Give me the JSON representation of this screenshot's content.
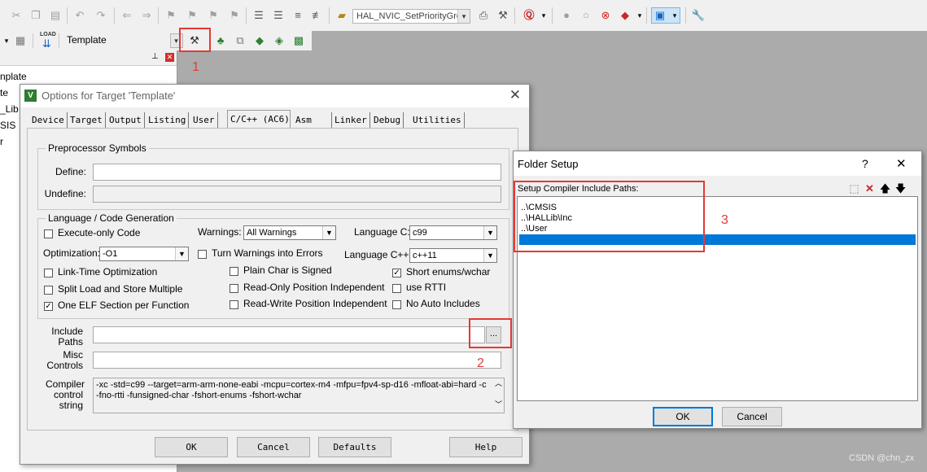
{
  "toolbar": {
    "function_combo": "HAL_NVIC_SetPriorityGro",
    "target_combo": "Template",
    "load_label": "LOAD"
  },
  "project_tree": [
    "nplate",
    "te",
    "_Lib",
    "SIS",
    "r"
  ],
  "annotations": {
    "n1": "1",
    "n2": "2",
    "n3": "3",
    "color": "#e53935"
  },
  "options_dialog": {
    "title": "Options for Target 'Template'",
    "tabs": [
      "Device",
      "Target",
      "Output",
      "Listing",
      "User",
      "C/C++ (AC6)",
      "Asm",
      "Linker",
      "Debug",
      "Utilities"
    ],
    "active_tab": "C/C++ (AC6)",
    "preprocessor": {
      "group_label": "Preprocessor Symbols",
      "define_label": "Define:",
      "define_value": "",
      "undefine_label": "Undefine:",
      "undefine_value": ""
    },
    "codegen": {
      "group_label": "Language / Code Generation",
      "execute_only": "Execute-only Code",
      "warnings_label": "Warnings:",
      "warnings_value": "All Warnings",
      "language_c_label": "Language C:",
      "language_c_value": "c99",
      "optimization_label": "Optimization:",
      "optimization_value": "-O1",
      "turn_warnings": "Turn Warnings into Errors",
      "language_cpp_label": "Language C++:",
      "language_cpp_value": "c++11",
      "link_time": "Link-Time Optimization",
      "plain_char": "Plain Char is Signed",
      "short_enums": "Short enums/wchar",
      "split_load": "Split Load and Store Multiple",
      "ropi": "Read-Only Position Independent",
      "use_rtti": "use RTTI",
      "one_elf": "One ELF Section per Function",
      "rwpi": "Read-Write Position Independent",
      "no_auto": "No Auto Includes",
      "checked_mark": "✓"
    },
    "include_paths_label_1": "Include",
    "include_paths_label_2": "Paths",
    "include_browse": "...",
    "misc_label_1": "Misc",
    "misc_label_2": "Controls",
    "compiler_label_1": "Compiler",
    "compiler_label_2": "control",
    "compiler_label_3": "string",
    "compiler_string_1": "-xc -std=c99 --target=arm-arm-none-eabi -mcpu=cortex-m4 -mfpu=fpv4-sp-d16 -mfloat-abi=hard -c",
    "compiler_string_2": "-fno-rtti -funsigned-char -fshort-enums -fshort-wchar",
    "buttons": {
      "ok": "OK",
      "cancel": "Cancel",
      "defaults": "Defaults",
      "help": "Help"
    }
  },
  "folder_setup": {
    "title": "Folder Setup",
    "help": "?",
    "close": "✕",
    "list_label": "Setup Compiler Include Paths:",
    "paths": [
      "..\\CMSIS",
      "..\\HALLib\\Inc",
      "..\\User"
    ],
    "ok": "OK",
    "cancel": "Cancel"
  },
  "watermark": "CSDN @chn_zx"
}
